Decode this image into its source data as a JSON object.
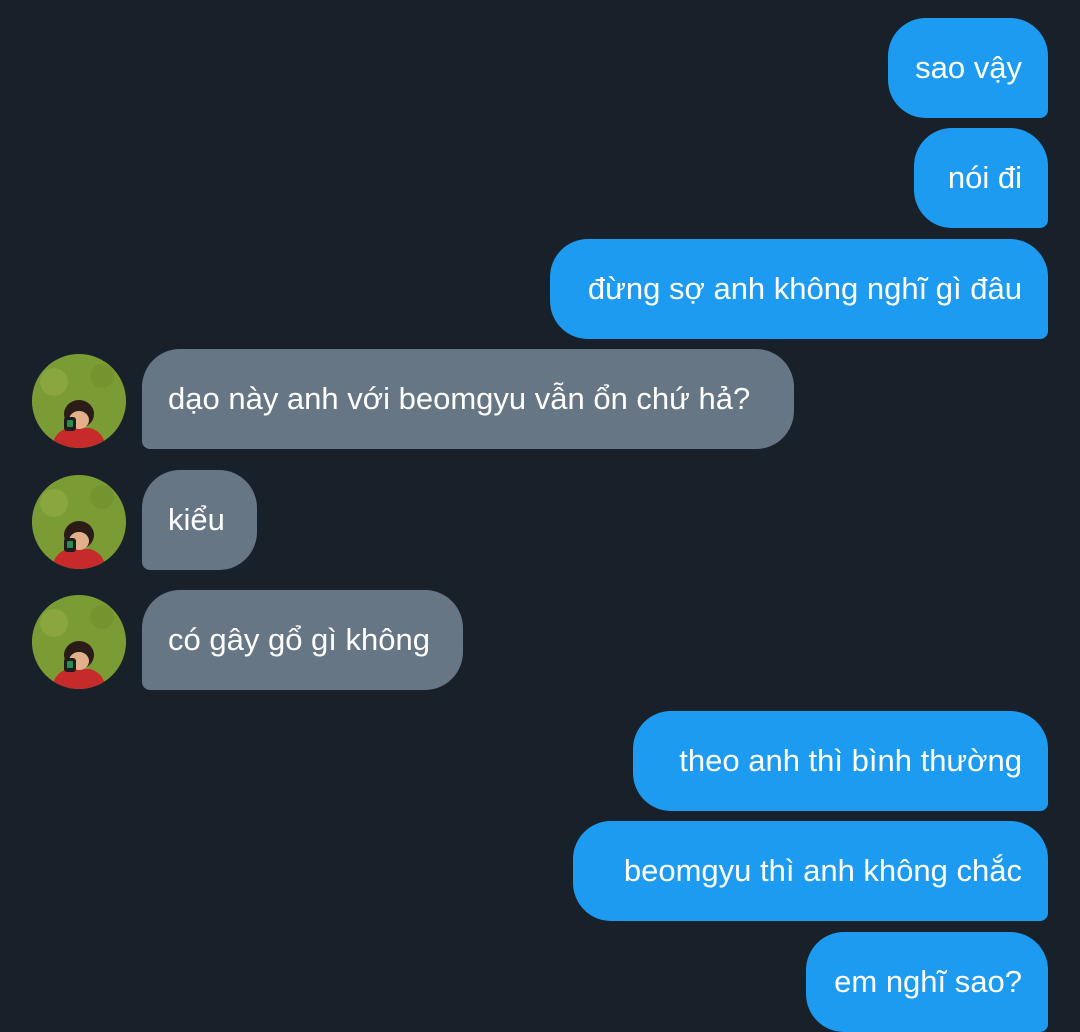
{
  "conversation": {
    "messages": [
      {
        "side": "out",
        "text": "sao vậy"
      },
      {
        "side": "out",
        "text": "nói đi"
      },
      {
        "side": "out",
        "text": "đừng sợ anh không nghĩ gì đâu"
      },
      {
        "side": "in",
        "text": "dạo này anh với beomgyu vẫn ổn chứ hả?",
        "avatar_icon": "profile-photo-icon"
      },
      {
        "side": "in",
        "text": "kiểu",
        "avatar_icon": "profile-photo-icon"
      },
      {
        "side": "in",
        "text": "có gây gổ gì không",
        "avatar_icon": "profile-photo-icon"
      },
      {
        "side": "out",
        "text": "theo anh thì bình thường"
      },
      {
        "side": "out",
        "text": "beomgyu thì anh không chắc"
      },
      {
        "side": "out",
        "text": "em nghĩ sao?"
      }
    ]
  },
  "colors": {
    "background": "#18202a",
    "outgoing_bubble": "#1d9bf0",
    "incoming_bubble": "#667685",
    "text": "#ffffff"
  }
}
